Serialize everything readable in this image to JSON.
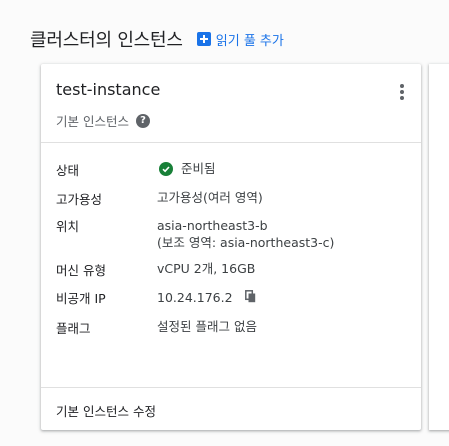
{
  "section": {
    "title": "클러스터의 인스턴스",
    "add_read_pool_label": "읽기 풀 추가"
  },
  "card": {
    "instance_name": "test-instance",
    "instance_type": "기본 인스턴스",
    "rows": {
      "status": {
        "label": "상태",
        "value": "준비됨"
      },
      "availability": {
        "label": "고가용성",
        "value": "고가용성(여러 영역)"
      },
      "location": {
        "label": "위치",
        "value_line1": "asia-northeast3-b",
        "value_line2": "(보조 영역: asia-northeast3-c)"
      },
      "machine_type": {
        "label": "머신 유형",
        "value": "vCPU 2개, 16GB"
      },
      "private_ip": {
        "label": "비공개 IP",
        "value": "10.24.176.2"
      },
      "flags": {
        "label": "플래그",
        "value": "설정된 플래그 없음"
      }
    },
    "edit_link_label": "기본 인스턴스 수정"
  },
  "colors": {
    "accent": "#1a73e8",
    "status_ok": "#188038",
    "icon_gray": "#5f6368"
  },
  "icons": [
    "plus-icon",
    "more-vert-icon",
    "help-icon",
    "check-circle-icon",
    "copy-icon"
  ]
}
